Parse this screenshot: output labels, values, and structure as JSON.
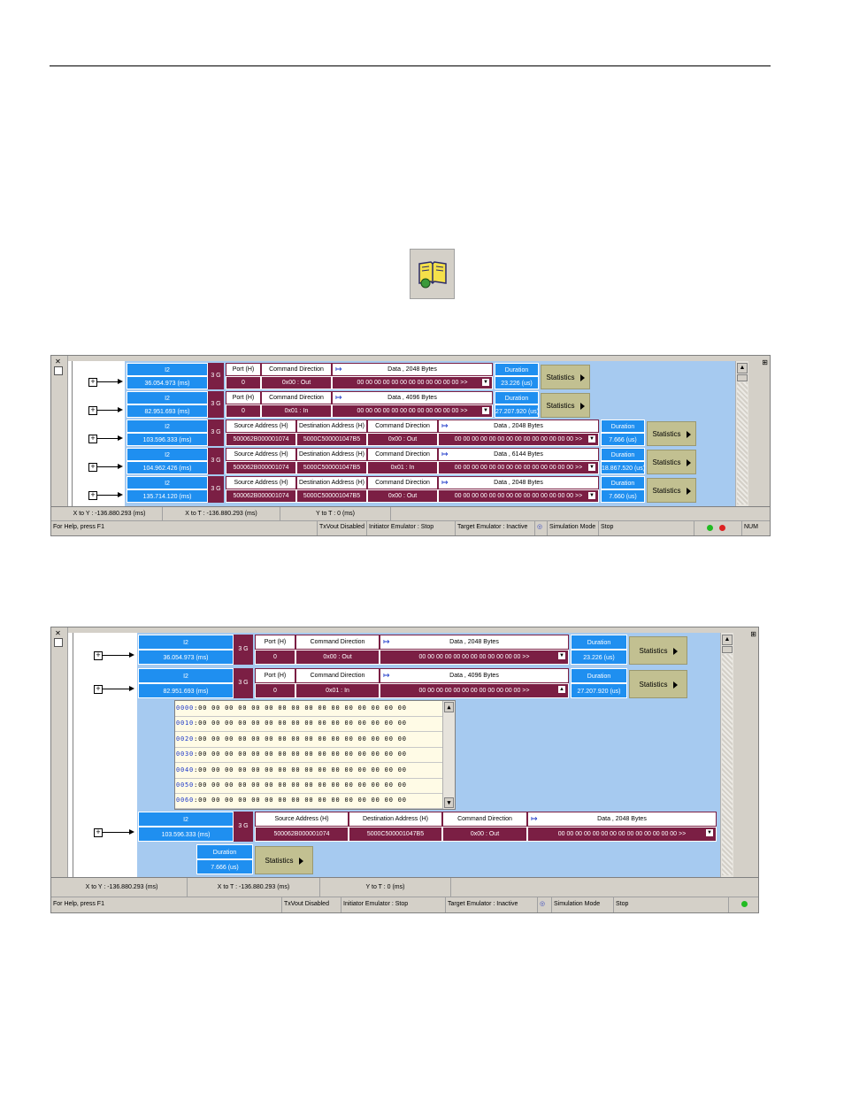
{
  "labels": {
    "i2": "I2",
    "g3": "3 G",
    "port": "Port (H)",
    "cmd_dir": "Command Direction",
    "src_addr": "Source Address (H)",
    "dst_addr": "Destination Address (H)",
    "duration": "Duration",
    "statistics": "Statistics"
  },
  "frames": [
    {
      "time": "36.054.973 (ms)",
      "port": "0",
      "cmd": "0x00 : Out",
      "data_header": "Data , 2048 Bytes",
      "data": "00 00 00 00 00 00 00 00 00 00 00 00  >>",
      "duration": "23.226 (us)"
    },
    {
      "time": "82.951.693 (ms)",
      "port": "0",
      "cmd": "0x01 : In",
      "data_header": "Data , 4096 Bytes",
      "data": "00 00 00 00 00 00 00 00 00 00 00 00  >>",
      "duration": "27.207.920 (us)"
    },
    {
      "time": "103.596.333 (ms)",
      "src": "500062B000001074",
      "dst": "5000C500001047B5",
      "cmd": "0x00 : Out",
      "data_header": "Data , 2048 Bytes",
      "data": "00 00 00 00 00 00 00 00 00 00 00 00 00 00  >>",
      "duration": "7.666 (us)"
    },
    {
      "time": "104.962.426 (ms)",
      "src": "500062B000001074",
      "dst": "5000C500001047B5",
      "cmd": "0x01 : In",
      "data_header": "Data , 6144 Bytes",
      "data": "00 00 00 00 00 00 00 00 00 00 00 00 00 00  >>",
      "duration": "18.867.520 (us)"
    },
    {
      "time": "135.714.120 (ms)",
      "src": "500062B000001074",
      "dst": "5000C500001047B5",
      "cmd": "0x00 : Out",
      "data_header": "Data , 2048 Bytes",
      "data": "00 00 00 00 00 00 00 00 00 00 00 00 00 00  >>",
      "duration": "7.660 (us)"
    }
  ],
  "measure": {
    "x_to_y": "X to Y : -136.880.293 (ms)",
    "x_to_t": "X to T : -136.880.293 (ms)",
    "y_to_t": "Y to T : 0 (ms)"
  },
  "status": {
    "help": "For Help, press F1",
    "txvout": "TxVout Disabled",
    "initiator": "Initiator Emulator : Stop",
    "target": "Target Emulator : Inactive",
    "sim_mode": "Simulation Mode",
    "sim_state": "Stop",
    "num": "NUM"
  },
  "hex": {
    "rows": [
      {
        "off": "0000",
        "bytes": ":00  00  00  00  00  00  00  00  00  00  00  00  00  00  00  00"
      },
      {
        "off": "0010",
        "bytes": ":00  00  00  00  00  00  00  00  00  00  00  00  00  00  00  00"
      },
      {
        "off": "0020",
        "bytes": ":00  00  00  00  00  00  00  00  00  00  00  00  00  00  00  00"
      },
      {
        "off": "0030",
        "bytes": ":00  00  00  00  00  00  00  00  00  00  00  00  00  00  00  00"
      },
      {
        "off": "0040",
        "bytes": ":00  00  00  00  00  00  00  00  00  00  00  00  00  00  00  00"
      },
      {
        "off": "0050",
        "bytes": ":00  00  00  00  00  00  00  00  00  00  00  00  00  00  00  00"
      },
      {
        "off": "0060",
        "bytes": ":00  00  00  00  00  00  00  00  00  00  00  00  00  00  00  00"
      }
    ]
  },
  "icons": {
    "toolbar": "open-book-icon",
    "status_green": "#22bb22",
    "status_red": "#dd2222"
  },
  "colors": {
    "field_blue": "#1f8ff0",
    "field_maroon": "#7b1f44",
    "trace_bg": "#a6caf0",
    "stat_bg": "#c2c091"
  }
}
